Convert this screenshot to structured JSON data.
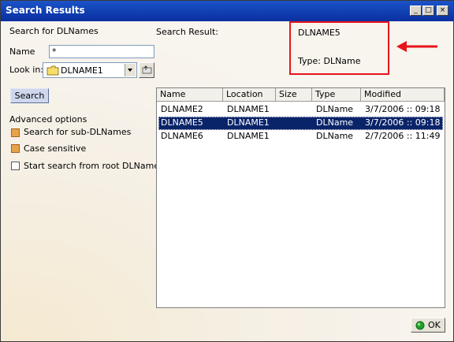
{
  "window": {
    "title": "Search Results"
  },
  "titlebar_buttons": {
    "minimize": "_",
    "maximize": "□",
    "close": "×"
  },
  "search": {
    "header": "Search for DLNames",
    "name_label": "Name",
    "name_value": "*",
    "lookin_label": "Look in:",
    "lookin_value": "DLNAME1",
    "search_button": "Search"
  },
  "advanced": {
    "title": "Advanced options",
    "options": [
      {
        "label": "Search for sub-DLNames",
        "checked": true
      },
      {
        "label": "Case sensitive",
        "checked": true
      },
      {
        "label": "Start search from root DLName",
        "checked": false
      }
    ]
  },
  "result": {
    "label": "Search Result:",
    "name": "DLNAME5",
    "type": "Type: DLName"
  },
  "table": {
    "columns": [
      "Name",
      "Location",
      "Size",
      "Type",
      "Modified"
    ],
    "rows": [
      [
        "DLNAME2",
        "DLNAME1",
        "",
        "DLName",
        "3/7/2006 :: 09:18"
      ],
      [
        "DLNAME5",
        "DLNAME1",
        "",
        "DLName",
        "3/7/2006 :: 09:18"
      ],
      [
        "DLNAME6",
        "DLNAME1",
        "",
        "DLName",
        "2/7/2006 :: 11:49"
      ]
    ],
    "selected_row": 1
  },
  "ok_button": "OK",
  "colors": {
    "titlebar": "#0a2fa0",
    "selection": "#0a246a",
    "highlight_box": "#e8141a",
    "checkbox_on": "#e6a34a"
  }
}
